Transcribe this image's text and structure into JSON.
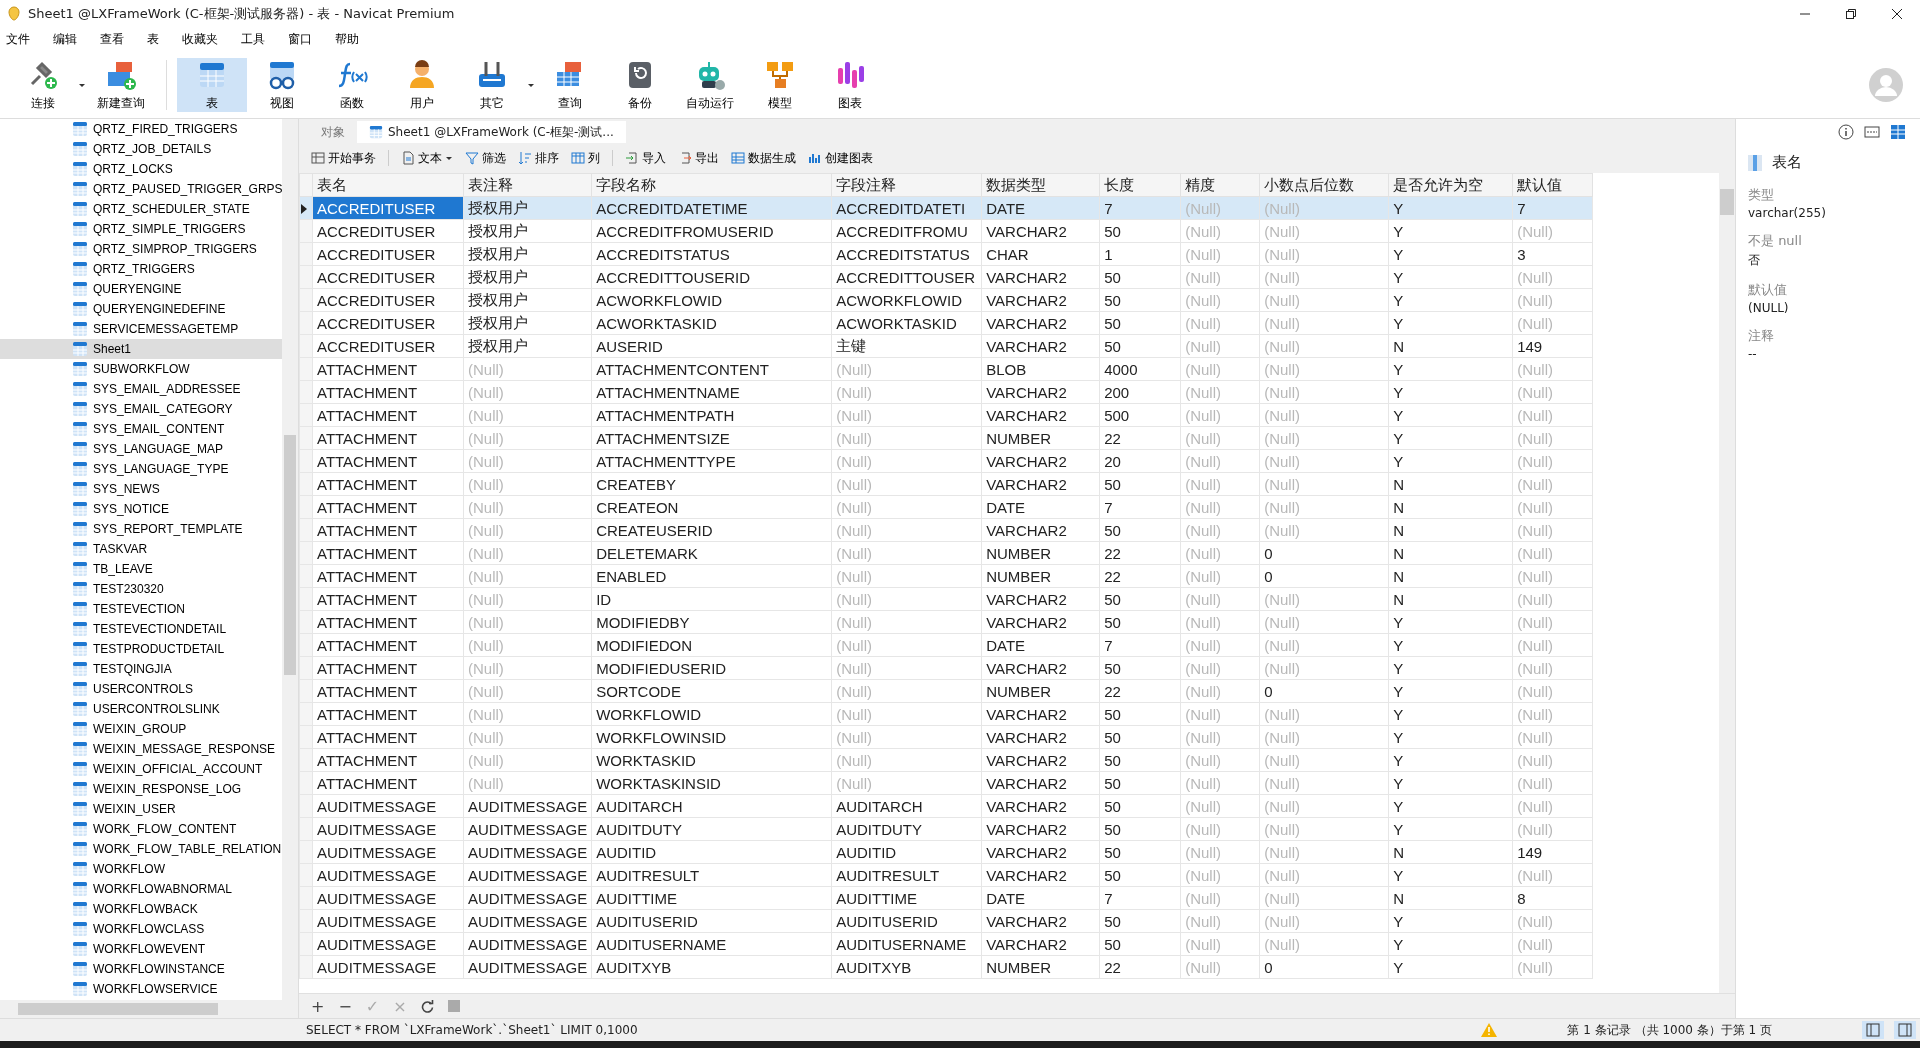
{
  "window": {
    "title": "Sheet1 @LXFrameWork (C-框架-测试服务器) - 表 - Navicat Premium"
  },
  "menu": [
    "文件",
    "编辑",
    "查看",
    "表",
    "收藏夹",
    "工具",
    "窗口",
    "帮助"
  ],
  "toolbar": [
    {
      "label": "连接",
      "selected": false,
      "dropdown": true
    },
    {
      "label": "新建查询",
      "selected": false,
      "dropdown": false
    },
    {
      "label": "表",
      "selected": true,
      "dropdown": false
    },
    {
      "label": "视图",
      "selected": false,
      "dropdown": false
    },
    {
      "label": "函数",
      "selected": false,
      "dropdown": false
    },
    {
      "label": "用户",
      "selected": false,
      "dropdown": false
    },
    {
      "label": "其它",
      "selected": false,
      "dropdown": true
    },
    {
      "label": "查询",
      "selected": false,
      "dropdown": false
    },
    {
      "label": "备份",
      "selected": false,
      "dropdown": false
    },
    {
      "label": "自动运行",
      "selected": false,
      "dropdown": false
    },
    {
      "label": "模型",
      "selected": false,
      "dropdown": false
    },
    {
      "label": "图表",
      "selected": false,
      "dropdown": false
    }
  ],
  "sidebar": {
    "items": [
      {
        "label": "QRTZ_FIRED_TRIGGERS",
        "selected": false
      },
      {
        "label": "QRTZ_JOB_DETAILS",
        "selected": false
      },
      {
        "label": "QRTZ_LOCKS",
        "selected": false
      },
      {
        "label": "QRTZ_PAUSED_TRIGGER_GRPS",
        "selected": false
      },
      {
        "label": "QRTZ_SCHEDULER_STATE",
        "selected": false
      },
      {
        "label": "QRTZ_SIMPLE_TRIGGERS",
        "selected": false
      },
      {
        "label": "QRTZ_SIMPROP_TRIGGERS",
        "selected": false
      },
      {
        "label": "QRTZ_TRIGGERS",
        "selected": false
      },
      {
        "label": "QUERYENGINE",
        "selected": false
      },
      {
        "label": "QUERYENGINEDEFINE",
        "selected": false
      },
      {
        "label": "SERVICEMESSAGETEMP",
        "selected": false
      },
      {
        "label": "Sheet1",
        "selected": true
      },
      {
        "label": "SUBWORKFLOW",
        "selected": false
      },
      {
        "label": "SYS_EMAIL_ADDRESSEE",
        "selected": false
      },
      {
        "label": "SYS_EMAIL_CATEGORY",
        "selected": false
      },
      {
        "label": "SYS_EMAIL_CONTENT",
        "selected": false
      },
      {
        "label": "SYS_LANGUAGE_MAP",
        "selected": false
      },
      {
        "label": "SYS_LANGUAGE_TYPE",
        "selected": false
      },
      {
        "label": "SYS_NEWS",
        "selected": false
      },
      {
        "label": "SYS_NOTICE",
        "selected": false
      },
      {
        "label": "SYS_REPORT_TEMPLATE",
        "selected": false
      },
      {
        "label": "TASKVAR",
        "selected": false
      },
      {
        "label": "TB_LEAVE",
        "selected": false
      },
      {
        "label": "TEST230320",
        "selected": false
      },
      {
        "label": "TESTEVECTION",
        "selected": false
      },
      {
        "label": "TESTEVECTIONDETAIL",
        "selected": false
      },
      {
        "label": "TESTPRODUCTDETAIL",
        "selected": false
      },
      {
        "label": "TESTQINGJIA",
        "selected": false
      },
      {
        "label": "USERCONTROLS",
        "selected": false
      },
      {
        "label": "USERCONTROLSLINK",
        "selected": false
      },
      {
        "label": "WEIXIN_GROUP",
        "selected": false
      },
      {
        "label": "WEIXIN_MESSAGE_RESPONSE",
        "selected": false
      },
      {
        "label": "WEIXIN_OFFICIAL_ACCOUNT",
        "selected": false
      },
      {
        "label": "WEIXIN_RESPONSE_LOG",
        "selected": false
      },
      {
        "label": "WEIXIN_USER",
        "selected": false
      },
      {
        "label": "WORK_FLOW_CONTENT",
        "selected": false
      },
      {
        "label": "WORK_FLOW_TABLE_RELATION",
        "selected": false
      },
      {
        "label": "WORKFLOW",
        "selected": false
      },
      {
        "label": "WORKFLOWABNORMAL",
        "selected": false
      },
      {
        "label": "WORKFLOWBACK",
        "selected": false
      },
      {
        "label": "WORKFLOWCLASS",
        "selected": false
      },
      {
        "label": "WORKFLOWEVENT",
        "selected": false
      },
      {
        "label": "WORKFLOWINSTANCE",
        "selected": false
      },
      {
        "label": "WORKFLOWSERVICE",
        "selected": false
      }
    ]
  },
  "tabs": [
    {
      "label": "对象",
      "selected": false
    },
    {
      "label": "Sheet1 @LXFrameWork (C-框架-测试...",
      "selected": true
    }
  ],
  "grid_toolbar": [
    {
      "label": "开始事务",
      "dropdown": false
    },
    {
      "label": "文本",
      "dropdown": true
    },
    {
      "label": "筛选",
      "dropdown": false
    },
    {
      "label": "排序",
      "dropdown": false
    },
    {
      "label": "列",
      "dropdown": false
    },
    {
      "label": "导入",
      "dropdown": false
    },
    {
      "label": "导出",
      "dropdown": false
    },
    {
      "label": "数据生成",
      "dropdown": false
    },
    {
      "label": "创建图表",
      "dropdown": false
    }
  ],
  "table": {
    "columns": [
      "表名",
      "表注释",
      "字段名称",
      "字段注释",
      "数据类型",
      "长度",
      "精度",
      "小数点后位数",
      "是否允许为空",
      "默认值"
    ],
    "rows": [
      {
        "selected": true,
        "cells": [
          "ACCREDITUSER",
          "授权用户",
          "ACCREDITDATETIME",
          "ACCREDITDATETI",
          "DATE",
          "7",
          {
            "text": "(Null)",
            "null": true
          },
          {
            "text": "(Null)",
            "null": true
          },
          "Y",
          "7"
        ]
      },
      {
        "selected": false,
        "cells": [
          "ACCREDITUSER",
          "授权用户",
          "ACCREDITFROMUSERID",
          "ACCREDITFROMU",
          "VARCHAR2",
          "50",
          {
            "text": "(Null)",
            "null": true
          },
          {
            "text": "(Null)",
            "null": true
          },
          "Y",
          {
            "text": "(Null)",
            "null": true
          }
        ]
      },
      {
        "selected": false,
        "cells": [
          "ACCREDITUSER",
          "授权用户",
          "ACCREDITSTATUS",
          "ACCREDITSTATUS",
          "CHAR",
          "1",
          {
            "text": "(Null)",
            "null": true
          },
          {
            "text": "(Null)",
            "null": true
          },
          "Y",
          "3"
        ]
      },
      {
        "selected": false,
        "cells": [
          "ACCREDITUSER",
          "授权用户",
          "ACCREDITTOUSERID",
          "ACCREDITTOUSER",
          "VARCHAR2",
          "50",
          {
            "text": "(Null)",
            "null": true
          },
          {
            "text": "(Null)",
            "null": true
          },
          "Y",
          {
            "text": "(Null)",
            "null": true
          }
        ]
      },
      {
        "selected": false,
        "cells": [
          "ACCREDITUSER",
          "授权用户",
          "ACWORKFLOWID",
          "ACWORKFLOWID",
          "VARCHAR2",
          "50",
          {
            "text": "(Null)",
            "null": true
          },
          {
            "text": "(Null)",
            "null": true
          },
          "Y",
          {
            "text": "(Null)",
            "null": true
          }
        ]
      },
      {
        "selected": false,
        "cells": [
          "ACCREDITUSER",
          "授权用户",
          "ACWORKTASKID",
          "ACWORKTASKID",
          "VARCHAR2",
          "50",
          {
            "text": "(Null)",
            "null": true
          },
          {
            "text": "(Null)",
            "null": true
          },
          "Y",
          {
            "text": "(Null)",
            "null": true
          }
        ]
      },
      {
        "selected": false,
        "cells": [
          "ACCREDITUSER",
          "授权用户",
          "AUSERID",
          "主键",
          "VARCHAR2",
          "50",
          {
            "text": "(Null)",
            "null": true
          },
          {
            "text": "(Null)",
            "null": true
          },
          "N",
          "149"
        ]
      },
      {
        "selected": false,
        "cells": [
          "ATTACHMENT",
          {
            "text": "(Null)",
            "null": true
          },
          "ATTACHMENTCONTENT",
          {
            "text": "(Null)",
            "null": true
          },
          "BLOB",
          "4000",
          {
            "text": "(Null)",
            "null": true
          },
          {
            "text": "(Null)",
            "null": true
          },
          "Y",
          {
            "text": "(Null)",
            "null": true
          }
        ]
      },
      {
        "selected": false,
        "cells": [
          "ATTACHMENT",
          {
            "text": "(Null)",
            "null": true
          },
          "ATTACHMENTNAME",
          {
            "text": "(Null)",
            "null": true
          },
          "VARCHAR2",
          "200",
          {
            "text": "(Null)",
            "null": true
          },
          {
            "text": "(Null)",
            "null": true
          },
          "Y",
          {
            "text": "(Null)",
            "null": true
          }
        ]
      },
      {
        "selected": false,
        "cells": [
          "ATTACHMENT",
          {
            "text": "(Null)",
            "null": true
          },
          "ATTACHMENTPATH",
          {
            "text": "(Null)",
            "null": true
          },
          "VARCHAR2",
          "500",
          {
            "text": "(Null)",
            "null": true
          },
          {
            "text": "(Null)",
            "null": true
          },
          "Y",
          {
            "text": "(Null)",
            "null": true
          }
        ]
      },
      {
        "selected": false,
        "cells": [
          "ATTACHMENT",
          {
            "text": "(Null)",
            "null": true
          },
          "ATTACHMENTSIZE",
          {
            "text": "(Null)",
            "null": true
          },
          "NUMBER",
          "22",
          {
            "text": "(Null)",
            "null": true
          },
          {
            "text": "(Null)",
            "null": true
          },
          "Y",
          {
            "text": "(Null)",
            "null": true
          }
        ]
      },
      {
        "selected": false,
        "cells": [
          "ATTACHMENT",
          {
            "text": "(Null)",
            "null": true
          },
          "ATTACHMENTTYPE",
          {
            "text": "(Null)",
            "null": true
          },
          "VARCHAR2",
          "20",
          {
            "text": "(Null)",
            "null": true
          },
          {
            "text": "(Null)",
            "null": true
          },
          "Y",
          {
            "text": "(Null)",
            "null": true
          }
        ]
      },
      {
        "selected": false,
        "cells": [
          "ATTACHMENT",
          {
            "text": "(Null)",
            "null": true
          },
          "CREATEBY",
          {
            "text": "(Null)",
            "null": true
          },
          "VARCHAR2",
          "50",
          {
            "text": "(Null)",
            "null": true
          },
          {
            "text": "(Null)",
            "null": true
          },
          "N",
          {
            "text": "(Null)",
            "null": true
          }
        ]
      },
      {
        "selected": false,
        "cells": [
          "ATTACHMENT",
          {
            "text": "(Null)",
            "null": true
          },
          "CREATEON",
          {
            "text": "(Null)",
            "null": true
          },
          "DATE",
          "7",
          {
            "text": "(Null)",
            "null": true
          },
          {
            "text": "(Null)",
            "null": true
          },
          "N",
          {
            "text": "(Null)",
            "null": true
          }
        ]
      },
      {
        "selected": false,
        "cells": [
          "ATTACHMENT",
          {
            "text": "(Null)",
            "null": true
          },
          "CREATEUSERID",
          {
            "text": "(Null)",
            "null": true
          },
          "VARCHAR2",
          "50",
          {
            "text": "(Null)",
            "null": true
          },
          {
            "text": "(Null)",
            "null": true
          },
          "N",
          {
            "text": "(Null)",
            "null": true
          }
        ]
      },
      {
        "selected": false,
        "cells": [
          "ATTACHMENT",
          {
            "text": "(Null)",
            "null": true
          },
          "DELETEMARK",
          {
            "text": "(Null)",
            "null": true
          },
          "NUMBER",
          "22",
          {
            "text": "(Null)",
            "null": true
          },
          "0",
          "N",
          {
            "text": "(Null)",
            "null": true
          }
        ]
      },
      {
        "selected": false,
        "cells": [
          "ATTACHMENT",
          {
            "text": "(Null)",
            "null": true
          },
          "ENABLED",
          {
            "text": "(Null)",
            "null": true
          },
          "NUMBER",
          "22",
          {
            "text": "(Null)",
            "null": true
          },
          "0",
          "N",
          {
            "text": "(Null)",
            "null": true
          }
        ]
      },
      {
        "selected": false,
        "cells": [
          "ATTACHMENT",
          {
            "text": "(Null)",
            "null": true
          },
          "ID",
          {
            "text": "(Null)",
            "null": true
          },
          "VARCHAR2",
          "50",
          {
            "text": "(Null)",
            "null": true
          },
          {
            "text": "(Null)",
            "null": true
          },
          "N",
          {
            "text": "(Null)",
            "null": true
          }
        ]
      },
      {
        "selected": false,
        "cells": [
          "ATTACHMENT",
          {
            "text": "(Null)",
            "null": true
          },
          "MODIFIEDBY",
          {
            "text": "(Null)",
            "null": true
          },
          "VARCHAR2",
          "50",
          {
            "text": "(Null)",
            "null": true
          },
          {
            "text": "(Null)",
            "null": true
          },
          "Y",
          {
            "text": "(Null)",
            "null": true
          }
        ]
      },
      {
        "selected": false,
        "cells": [
          "ATTACHMENT",
          {
            "text": "(Null)",
            "null": true
          },
          "MODIFIEDON",
          {
            "text": "(Null)",
            "null": true
          },
          "DATE",
          "7",
          {
            "text": "(Null)",
            "null": true
          },
          {
            "text": "(Null)",
            "null": true
          },
          "Y",
          {
            "text": "(Null)",
            "null": true
          }
        ]
      },
      {
        "selected": false,
        "cells": [
          "ATTACHMENT",
          {
            "text": "(Null)",
            "null": true
          },
          "MODIFIEDUSERID",
          {
            "text": "(Null)",
            "null": true
          },
          "VARCHAR2",
          "50",
          {
            "text": "(Null)",
            "null": true
          },
          {
            "text": "(Null)",
            "null": true
          },
          "Y",
          {
            "text": "(Null)",
            "null": true
          }
        ]
      },
      {
        "selected": false,
        "cells": [
          "ATTACHMENT",
          {
            "text": "(Null)",
            "null": true
          },
          "SORTCODE",
          {
            "text": "(Null)",
            "null": true
          },
          "NUMBER",
          "22",
          {
            "text": "(Null)",
            "null": true
          },
          "0",
          "Y",
          {
            "text": "(Null)",
            "null": true
          }
        ]
      },
      {
        "selected": false,
        "cells": [
          "ATTACHMENT",
          {
            "text": "(Null)",
            "null": true
          },
          "WORKFLOWID",
          {
            "text": "(Null)",
            "null": true
          },
          "VARCHAR2",
          "50",
          {
            "text": "(Null)",
            "null": true
          },
          {
            "text": "(Null)",
            "null": true
          },
          "Y",
          {
            "text": "(Null)",
            "null": true
          }
        ]
      },
      {
        "selected": false,
        "cells": [
          "ATTACHMENT",
          {
            "text": "(Null)",
            "null": true
          },
          "WORKFLOWINSID",
          {
            "text": "(Null)",
            "null": true
          },
          "VARCHAR2",
          "50",
          {
            "text": "(Null)",
            "null": true
          },
          {
            "text": "(Null)",
            "null": true
          },
          "Y",
          {
            "text": "(Null)",
            "null": true
          }
        ]
      },
      {
        "selected": false,
        "cells": [
          "ATTACHMENT",
          {
            "text": "(Null)",
            "null": true
          },
          "WORKTASKID",
          {
            "text": "(Null)",
            "null": true
          },
          "VARCHAR2",
          "50",
          {
            "text": "(Null)",
            "null": true
          },
          {
            "text": "(Null)",
            "null": true
          },
          "Y",
          {
            "text": "(Null)",
            "null": true
          }
        ]
      },
      {
        "selected": false,
        "cells": [
          "ATTACHMENT",
          {
            "text": "(Null)",
            "null": true
          },
          "WORKTASKINSID",
          {
            "text": "(Null)",
            "null": true
          },
          "VARCHAR2",
          "50",
          {
            "text": "(Null)",
            "null": true
          },
          {
            "text": "(Null)",
            "null": true
          },
          "Y",
          {
            "text": "(Null)",
            "null": true
          }
        ]
      },
      {
        "selected": false,
        "cells": [
          "AUDITMESSAGE",
          "AUDITMESSAGE",
          "AUDITARCH",
          "AUDITARCH",
          "VARCHAR2",
          "50",
          {
            "text": "(Null)",
            "null": true
          },
          {
            "text": "(Null)",
            "null": true
          },
          "Y",
          {
            "text": "(Null)",
            "null": true
          }
        ]
      },
      {
        "selected": false,
        "cells": [
          "AUDITMESSAGE",
          "AUDITMESSAGE",
          "AUDITDUTY",
          "AUDITDUTY",
          "VARCHAR2",
          "50",
          {
            "text": "(Null)",
            "null": true
          },
          {
            "text": "(Null)",
            "null": true
          },
          "Y",
          {
            "text": "(Null)",
            "null": true
          }
        ]
      },
      {
        "selected": false,
        "cells": [
          "AUDITMESSAGE",
          "AUDITMESSAGE",
          "AUDITID",
          "AUDITID",
          "VARCHAR2",
          "50",
          {
            "text": "(Null)",
            "null": true
          },
          {
            "text": "(Null)",
            "null": true
          },
          "N",
          "149"
        ]
      },
      {
        "selected": false,
        "cells": [
          "AUDITMESSAGE",
          "AUDITMESSAGE",
          "AUDITRESULT",
          "AUDITRESULT",
          "VARCHAR2",
          "50",
          {
            "text": "(Null)",
            "null": true
          },
          {
            "text": "(Null)",
            "null": true
          },
          "Y",
          {
            "text": "(Null)",
            "null": true
          }
        ]
      },
      {
        "selected": false,
        "cells": [
          "AUDITMESSAGE",
          "AUDITMESSAGE",
          "AUDITTIME",
          "AUDITTIME",
          "DATE",
          "7",
          {
            "text": "(Null)",
            "null": true
          },
          {
            "text": "(Null)",
            "null": true
          },
          "N",
          "8"
        ]
      },
      {
        "selected": false,
        "cells": [
          "AUDITMESSAGE",
          "AUDITMESSAGE",
          "AUDITUSERID",
          "AUDITUSERID",
          "VARCHAR2",
          "50",
          {
            "text": "(Null)",
            "null": true
          },
          {
            "text": "(Null)",
            "null": true
          },
          "Y",
          {
            "text": "(Null)",
            "null": true
          }
        ]
      },
      {
        "selected": false,
        "cells": [
          "AUDITMESSAGE",
          "AUDITMESSAGE",
          "AUDITUSERNAME",
          "AUDITUSERNAME",
          "VARCHAR2",
          "50",
          {
            "text": "(Null)",
            "null": true
          },
          {
            "text": "(Null)",
            "null": true
          },
          "Y",
          {
            "text": "(Null)",
            "null": true
          }
        ]
      },
      {
        "selected": false,
        "cells": [
          "AUDITMESSAGE",
          "AUDITMESSAGE",
          "AUDITXYB",
          "AUDITXYB",
          "NUMBER",
          "22",
          {
            "text": "(Null)",
            "null": true
          },
          "0",
          "Y",
          {
            "text": "(Null)",
            "null": true
          }
        ]
      }
    ]
  },
  "nav_buttons": [
    "+",
    "−",
    "✓",
    "×"
  ],
  "sql": "SELECT * FROM `LXFrameWork`.`Sheet1` LIMIT 0,1000",
  "record_status": "第 1 条记录 （共 1000 条）于第 1 页",
  "inspector": {
    "view_icons": [
      {
        "selected": false
      },
      {
        "selected": false
      },
      {
        "selected": true
      }
    ],
    "title": "表名",
    "fields": [
      {
        "label": "类型",
        "value": "varchar(255)"
      },
      {
        "label": "不是 null",
        "value": "否"
      },
      {
        "label": "默认值",
        "value": "(NULL)"
      },
      {
        "label": "注释",
        "value": "--"
      }
    ]
  }
}
